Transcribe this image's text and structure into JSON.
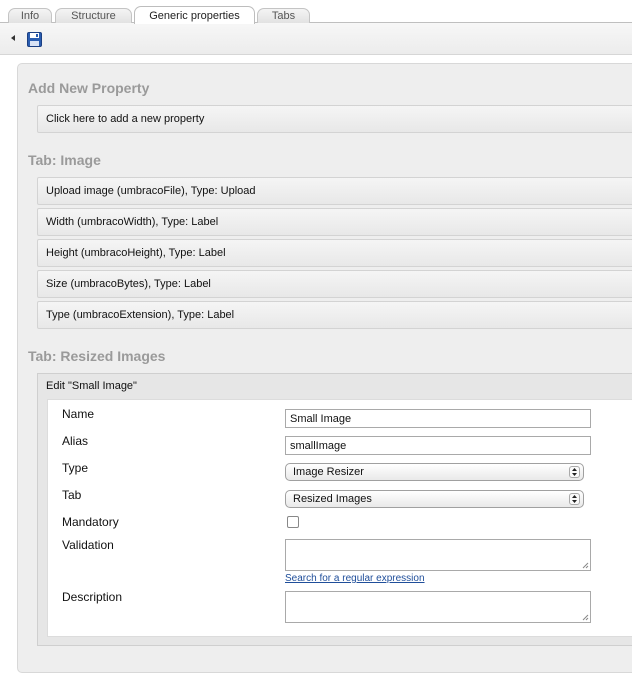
{
  "tabs": [
    {
      "label": "Info",
      "active": false
    },
    {
      "label": "Structure",
      "active": false
    },
    {
      "label": "Generic properties",
      "active": true
    },
    {
      "label": "Tabs",
      "active": false
    }
  ],
  "toolbar": {
    "back_icon": "back-arrow-icon",
    "save_icon": "save-disk-icon"
  },
  "add_section": {
    "title": "Add New Property",
    "add_bar_label": "Click here to add a new property"
  },
  "image_tab": {
    "title": "Tab: Image",
    "properties": [
      "Upload image (umbracoFile), Type: Upload",
      "Width (umbracoWidth), Type: Label",
      "Height (umbracoHeight), Type: Label",
      "Size (umbracoBytes), Type: Label",
      "Type (umbracoExtension), Type: Label"
    ]
  },
  "resized_tab": {
    "title": "Tab: Resized Images",
    "edit_header": "Edit \"Small Image\"",
    "form": {
      "name_label": "Name",
      "name_value": "Small Image",
      "alias_label": "Alias",
      "alias_value": "smallImage",
      "type_label": "Type",
      "type_value": "Image Resizer",
      "tab_label": "Tab",
      "tab_value": "Resized Images",
      "mandatory_label": "Mandatory",
      "mandatory_checked": false,
      "validation_label": "Validation",
      "validation_value": "",
      "regex_link": "Search for a regular expression",
      "description_label": "Description",
      "description_value": ""
    }
  },
  "colors": {
    "section_title": "#9a9a9a",
    "link": "#1f4e9a",
    "save_icon": "#2a5db0"
  }
}
